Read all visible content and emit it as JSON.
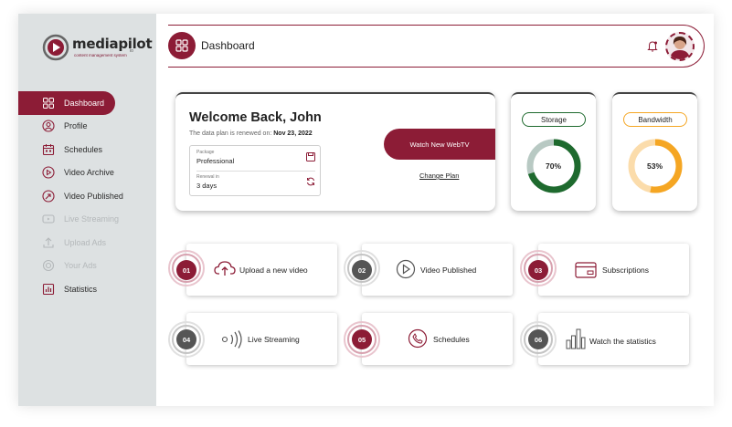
{
  "brand": {
    "name_part1": "media",
    "name_part2": "pilot",
    "tagline": "content management system",
    "sub": "io",
    "accent": "#8c1c36"
  },
  "sidebar": {
    "items": [
      {
        "label": "Dashboard",
        "icon": "grid-icon",
        "state": "active"
      },
      {
        "label": "Profile",
        "icon": "user-circle-icon",
        "state": "normal"
      },
      {
        "label": "Schedules",
        "icon": "calendar-icon",
        "state": "normal"
      },
      {
        "label": "Video Archive",
        "icon": "play-circle-icon",
        "state": "normal"
      },
      {
        "label": "Video Published",
        "icon": "rocket-icon",
        "state": "normal"
      },
      {
        "label": "Live Streaming",
        "icon": "youtube-icon",
        "state": "disabled"
      },
      {
        "label": "Upload Ads",
        "icon": "upload-icon",
        "state": "disabled"
      },
      {
        "label": "Your Ads",
        "icon": "target-icon",
        "state": "disabled"
      },
      {
        "label": "Statistics",
        "icon": "bar-chart-icon",
        "state": "normal"
      }
    ]
  },
  "header": {
    "title": "Dashboard",
    "icons": [
      "grid-icon",
      "bell-icon",
      "avatar"
    ]
  },
  "welcome": {
    "title": "Welcome Back, John",
    "renew_prefix": "The data plan is renewed on:",
    "renew_date": "Nov 23, 2022",
    "package_label": "Package",
    "package_value": "Professional",
    "renewal_label": "Renewal in",
    "renewal_value": "3 days",
    "watch_button": "Watch New WebTV",
    "change_plan": "Change Plan"
  },
  "storage": {
    "label": "Storage",
    "percent_text": "70%",
    "fraction": 0.7,
    "color": "#1e6a2e",
    "track_color": "#b8c9c3"
  },
  "bandwidth": {
    "label": "Bandwidth",
    "percent_text": "53%",
    "fraction": 0.53,
    "color": "#f5a623",
    "track_color": "#fbdcab"
  },
  "tiles": [
    {
      "num": "01",
      "label": "Upload a new video",
      "icon": "cloud-upload-icon",
      "color": "red"
    },
    {
      "num": "02",
      "label": "Video Published",
      "icon": "play-circle-icon",
      "color": "gray"
    },
    {
      "num": "03",
      "label": "Subscriptions",
      "icon": "credit-card-icon",
      "color": "red"
    },
    {
      "num": "04",
      "label": "Live Streaming",
      "icon": "broadcast-icon",
      "color": "gray"
    },
    {
      "num": "05",
      "label": "Schedules",
      "icon": "phone-icon",
      "color": "red"
    },
    {
      "num": "06",
      "label": "Watch the statistics",
      "icon": "bar-chart-icon",
      "color": "gray"
    }
  ]
}
